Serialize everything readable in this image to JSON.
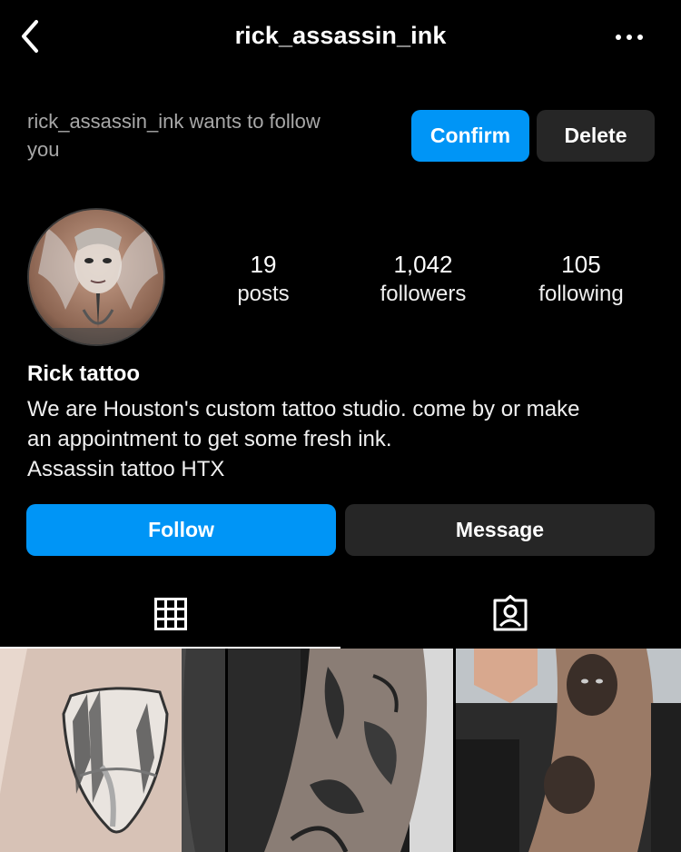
{
  "header": {
    "username": "rick_assassin_ink",
    "back_icon": "chevron-left-icon",
    "more_icon": "more-horizontal-icon"
  },
  "follow_request": {
    "text": "rick_assassin_ink wants to follow you",
    "confirm_label": "Confirm",
    "delete_label": "Delete"
  },
  "profile": {
    "avatar": "avatar",
    "stats": {
      "posts_count": "19",
      "posts_label": "posts",
      "followers_count": "1,042",
      "followers_label": "followers",
      "following_count": "105",
      "following_label": "following"
    },
    "name": "Rick tattoo",
    "bio_line1": "We are Houston's custom tattoo studio. come by or make",
    "bio_line2": "an appointment to get some fresh ink.",
    "bio_line3": "Assassin tattoo HTX",
    "follow_label": "Follow",
    "message_label": "Message"
  },
  "tabs": [
    {
      "icon": "grid-icon",
      "active": true
    },
    {
      "icon": "tagged-person-icon",
      "active": false
    }
  ],
  "colors": {
    "background": "#000000",
    "primary_button": "#0095f6",
    "secondary_button": "#262626",
    "muted_text": "#a8a8a8"
  }
}
